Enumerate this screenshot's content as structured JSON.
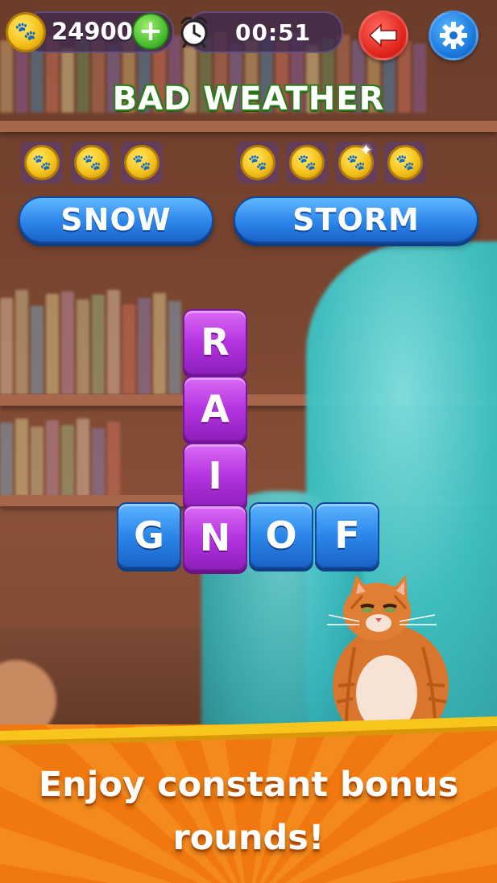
{
  "hud": {
    "coins": "24900",
    "timer": "00:51",
    "icons": {
      "coin": "paw-coin-icon",
      "add": "plus-icon",
      "clock": "alarm-clock-icon",
      "back": "back-arrow-icon",
      "settings": "gear-icon"
    }
  },
  "category": "BAD WEATHER",
  "hidden_words": {
    "left_coin_count": 3,
    "right_coin_count": 4
  },
  "found_words": [
    "SNOW",
    "STORM"
  ],
  "board": {
    "vertical_word": [
      "R",
      "A",
      "I",
      "N"
    ],
    "row_letters": [
      "G",
      "N",
      "O",
      "F"
    ]
  },
  "promo": {
    "line1": "Enjoy constant bonus",
    "line2": "rounds!"
  },
  "colors": {
    "tile_purple": "#b535e0",
    "tile_blue": "#2c87ea",
    "category_outline": "#2f7a1c",
    "banner_orange": "#f0780e"
  }
}
